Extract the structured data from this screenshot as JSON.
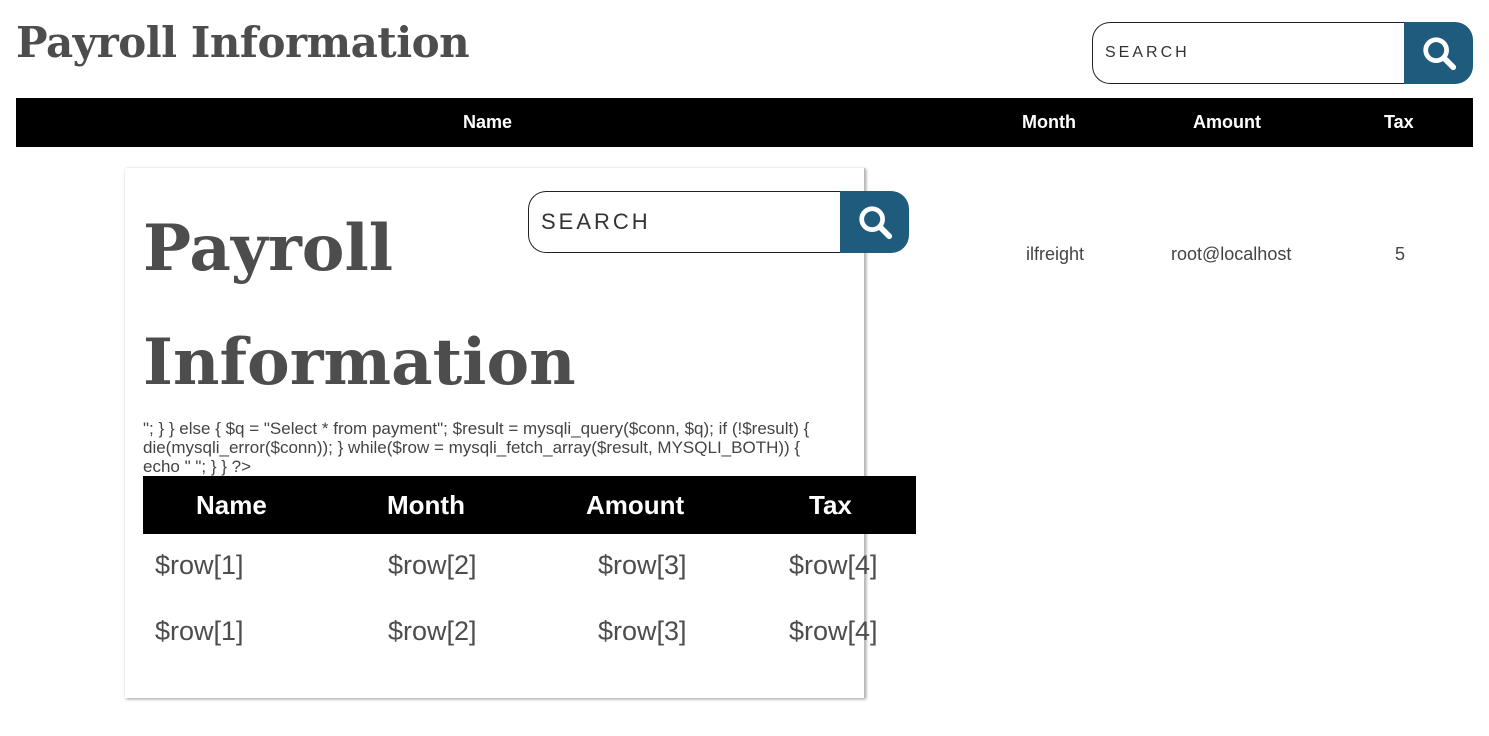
{
  "page": {
    "title": "Payroll Information",
    "search_placeholder": "SEARCH"
  },
  "table": {
    "headers": [
      "Name",
      "Month",
      "Amount",
      "Tax"
    ],
    "rows": [
      [
        "",
        "ilfreight",
        "root@localhost",
        "5"
      ]
    ]
  },
  "embedded": {
    "title": "Payroll Information",
    "search_placeholder": "SEARCH",
    "php_text": "\"; } } else { $q = \"Select * from payment\"; $result = mysqli_query($conn, $q); if (!$result) { die(mysqli_error($conn)); } while($row = mysqli_fetch_array($result, MYSQLI_BOTH)) { echo \" \"; } } ?>",
    "headers": [
      "Name",
      "Month",
      "Amount",
      "Tax"
    ],
    "rows": [
      [
        "$row[1]",
        "$row[2]",
        "$row[3]",
        "$row[4]"
      ],
      [
        "$row[1]",
        "$row[2]",
        "$row[3]",
        "$row[4]"
      ]
    ]
  },
  "colors": {
    "accent": "#1e5b7c",
    "header_bg": "#000000",
    "text": "#4d4d4d"
  },
  "icons": {
    "search": "search-icon"
  }
}
